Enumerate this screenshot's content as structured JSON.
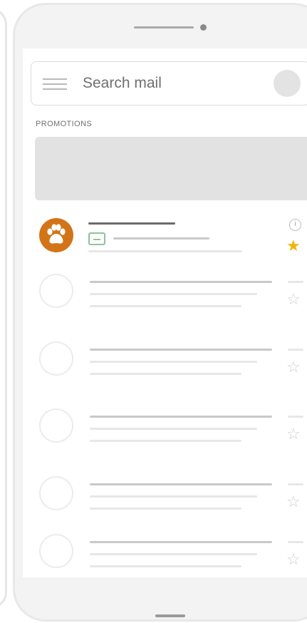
{
  "search": {
    "placeholder": "Search mail",
    "menu_icon": "hamburger-menu-icon",
    "avatar": "account-avatar"
  },
  "section": {
    "label": "PROMOTIONS"
  },
  "messages": [
    {
      "sender_icon": "paw-print-icon",
      "tag_icon": "promo-tag-icon",
      "info_icon": "info-icon",
      "starred": true
    },
    {
      "sender_icon": "blank-avatar",
      "starred": false
    },
    {
      "sender_icon": "blank-avatar",
      "starred": false
    },
    {
      "sender_icon": "blank-avatar",
      "starred": false
    },
    {
      "sender_icon": "blank-avatar",
      "starred": false
    },
    {
      "sender_icon": "blank-avatar",
      "starred": false
    }
  ],
  "glyphs": {
    "star_filled": "★",
    "star_empty": "☆",
    "info": "i"
  },
  "colors": {
    "brand_avatar": "#d27418",
    "star": "#f4b400",
    "promo_tag": "#8dc39a"
  }
}
